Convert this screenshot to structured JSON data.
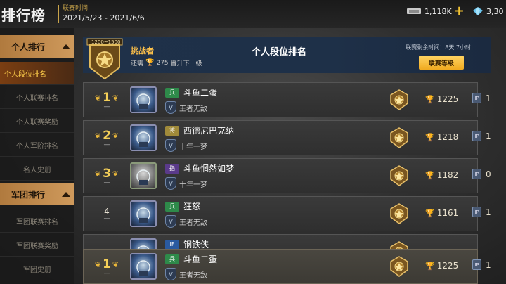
{
  "header": {
    "title": "排行榜",
    "season_label": "联赛时间",
    "season_range": "2021/5/23 - 2021/6/6",
    "currency_1": "1,118K",
    "currency_2": "3,30"
  },
  "sidebar": {
    "personal_section": "个人排行",
    "personal_items": [
      "个人段位排名",
      "个人联赛排名",
      "个人联赛奖励",
      "个人军阶排名",
      "名人史册"
    ],
    "legion_section": "军团排行",
    "legion_items": [
      "军团联赛排名",
      "军团联赛奖励",
      "军团史册"
    ],
    "active_index": 0
  },
  "tier_panel": {
    "score_range": "1200~1500",
    "tier_name": "挑战者",
    "need_prefix": "还需",
    "need_points": "275",
    "need_suffix": "晋升下一级",
    "title": "个人段位排名",
    "remaining": "联赛剩余时间：8天 7小时",
    "button": "联赛等级"
  },
  "rows": [
    {
      "rank": "1",
      "name": "斗鱼二蛋",
      "class_icon": "兵",
      "class_color": "#2e8a4a",
      "guild": "王者无敌",
      "score": "1225",
      "lp": "1"
    },
    {
      "rank": "2",
      "name": "西德尼巴克纳",
      "class_icon": "将",
      "class_color": "#a08a3a",
      "guild": "十年一梦",
      "score": "1218",
      "lp": "1"
    },
    {
      "rank": "3",
      "name": "斗鱼惘然如梦",
      "class_icon": "指",
      "class_color": "#5a3a8a",
      "guild": "十年一梦",
      "score": "1182",
      "lp": "0"
    },
    {
      "rank": "4",
      "name": "狂怒",
      "class_icon": "兵",
      "class_color": "#2e8a4a",
      "guild": "王者无敌",
      "score": "1161",
      "lp": "1"
    },
    {
      "rank": "",
      "name": "钢铁侠",
      "class_icon": "IF",
      "class_color": "#2a5aa0",
      "guild": "",
      "score": "",
      "lp": ""
    }
  ],
  "my_row": {
    "rank": "1",
    "name": "斗鱼二蛋",
    "class_icon": "兵",
    "class_color": "#2e8a4a",
    "guild": "王者无敌",
    "score": "1225",
    "lp": "1"
  },
  "colors": {
    "accent_gold": "#f4cf58",
    "sidebar_head": "#cf9a5c",
    "active_item": "#7a3e12"
  }
}
